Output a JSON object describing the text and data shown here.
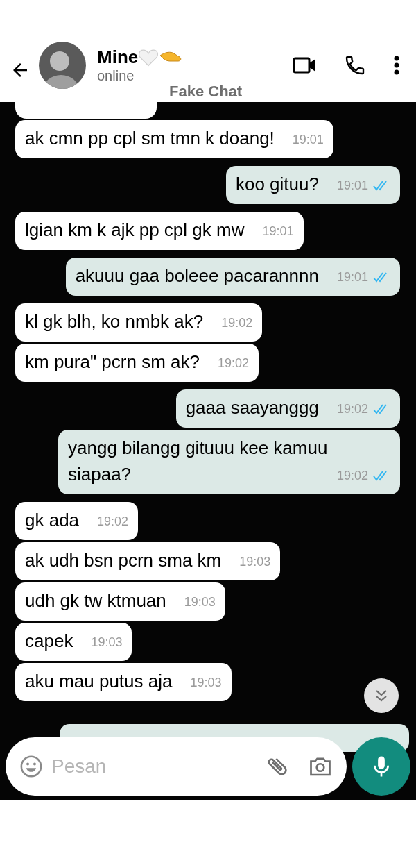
{
  "header": {
    "contact_name": "Mine",
    "presence": "online",
    "caption": "Fake Chat"
  },
  "messages": [
    {
      "kind": "in",
      "text": "ak cmn pp cpl sm tmn k doang!",
      "time": "19:01"
    },
    {
      "kind": "out",
      "text": "koo gituu?",
      "time": "19:01",
      "read": true
    },
    {
      "kind": "in",
      "text": "lgian km k ajk pp cpl gk mw",
      "time": "19:01"
    },
    {
      "kind": "out",
      "text": "akuuu gaa boleee pacarannnn",
      "time": "19:01",
      "read": true
    },
    {
      "kind": "in",
      "text": "kl gk blh, ko nmbk ak?",
      "time": "19:02"
    },
    {
      "kind": "in",
      "text": "km pura\" pcrn sm ak?",
      "time": "19:02"
    },
    {
      "kind": "out",
      "text": "gaaa saayanggg",
      "time": "19:02",
      "read": true
    },
    {
      "kind": "out",
      "text": "yangg bilangg gituuu kee kamuu siapaa?",
      "time": "19:02",
      "read": true
    },
    {
      "kind": "in",
      "text": "gk ada",
      "time": "19:02"
    },
    {
      "kind": "in",
      "text": "ak udh bsn pcrn sma km",
      "time": "19:03"
    },
    {
      "kind": "in",
      "text": "udh gk tw ktmuan",
      "time": "19:03"
    },
    {
      "kind": "in",
      "text": "capek",
      "time": "19:03"
    },
    {
      "kind": "in",
      "text": "aku mau putus aja",
      "time": "19:03"
    }
  ],
  "composer": {
    "placeholder": "Pesan"
  }
}
